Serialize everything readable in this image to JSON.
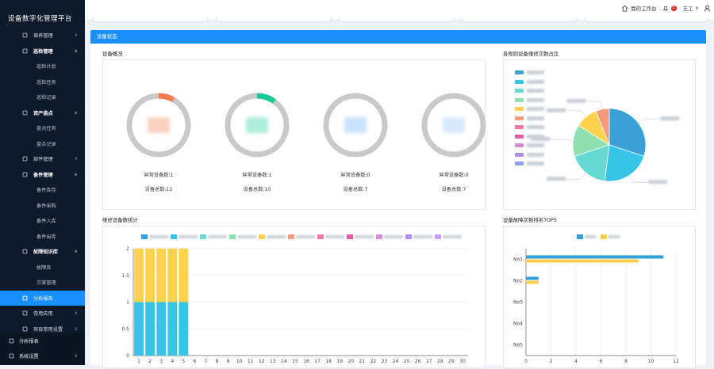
{
  "app": {
    "title": "设备数字化管理平台"
  },
  "sidebar": {
    "items": [
      {
        "label": "保养管理",
        "level": 1,
        "open": false,
        "icon": "doc-icon"
      },
      {
        "label": "巡检管理",
        "level": 1,
        "open": true,
        "icon": "gear-icon"
      },
      {
        "label": "巡检计划",
        "level": 2
      },
      {
        "label": "巡检任务",
        "level": 2
      },
      {
        "label": "巡检记录",
        "level": 2
      },
      {
        "label": "资产盘点",
        "level": 1,
        "open": true,
        "icon": "gear-icon"
      },
      {
        "label": "盘点任务",
        "level": 2
      },
      {
        "label": "盘点记录",
        "level": 2
      },
      {
        "label": "部件管理",
        "level": 1,
        "open": false,
        "icon": "wrench-icon"
      },
      {
        "label": "备件管理",
        "level": 1,
        "open": true,
        "icon": "parts-icon"
      },
      {
        "label": "备件库存",
        "level": 2
      },
      {
        "label": "备件采购",
        "level": 2
      },
      {
        "label": "备件入库",
        "level": 2
      },
      {
        "label": "备件出库",
        "level": 2
      },
      {
        "label": "故障知识库",
        "level": 1,
        "open": true,
        "icon": "book-icon"
      },
      {
        "label": "故障库",
        "level": 2
      },
      {
        "label": "方案管理",
        "level": 2
      },
      {
        "label": "分析报告",
        "level": 1,
        "active": true,
        "icon": "user-icon"
      },
      {
        "label": "常用应用",
        "level": 1,
        "open": false,
        "icon": "apps-icon"
      },
      {
        "label": "项目常用设置",
        "level": 1,
        "open": false,
        "icon": "apps-icon"
      },
      {
        "label": "分析报表",
        "level": 0,
        "icon": "report-icon"
      },
      {
        "label": "系统设置",
        "level": 0,
        "open": false,
        "icon": "settings-icon"
      }
    ]
  },
  "topbar": {
    "workbench": "我的工作台",
    "notifications": "0",
    "user": "王工"
  },
  "banner": {
    "title": "设备状态"
  },
  "sections": {
    "overview": "设备概况",
    "ratio": "各规则设备维修次数占比",
    "repair_stats": "维修设备数统计",
    "fault_rank": "设备故障次数排名TOP5"
  },
  "gauges": [
    {
      "abnormal": "异常设备数:1",
      "total": "设备总数:12",
      "ratio": 0.0833,
      "color": "#f47c4e"
    },
    {
      "abnormal": "异常设备数:1",
      "total": "设备总数:10",
      "ratio": 0.1,
      "color": "#19c999"
    },
    {
      "abnormal": "异常设备数:0",
      "total": "设备总数:7",
      "ratio": 0,
      "color": "#6aaef2"
    },
    {
      "abnormal": "异常设备数:0",
      "total": "设备总数:7",
      "ratio": 0,
      "color": "#8fc1f0"
    }
  ],
  "pie": {
    "legend_colors": [
      "#3aa0d8",
      "#36c5e6",
      "#66d9d3",
      "#8fe0b0",
      "#ffd24d",
      "#f59a7c",
      "#f07ba0",
      "#e35fa5",
      "#d38bd8",
      "#b08fe6",
      "#8f9ff0"
    ],
    "slices": [
      {
        "value": 30,
        "color": "#3aa0d8"
      },
      {
        "value": 22,
        "color": "#36c5e6"
      },
      {
        "value": 18,
        "color": "#66d9d3"
      },
      {
        "value": 14,
        "color": "#8fe0b0"
      },
      {
        "value": 10,
        "color": "#ffd24d"
      },
      {
        "value": 6,
        "color": "#f59a7c"
      }
    ]
  },
  "chart_data": [
    {
      "type": "bar",
      "stacked": true,
      "categories": [
        "1",
        "2",
        "3",
        "4",
        "5",
        "6",
        "7",
        "8",
        "9",
        "10",
        "11",
        "12",
        "13",
        "14",
        "15",
        "16",
        "17",
        "18",
        "19",
        "20",
        "21",
        "22",
        "23",
        "24",
        "25",
        "26",
        "27",
        "28",
        "29",
        "30"
      ],
      "series": [
        {
          "color": "#36c5e6",
          "values": [
            1,
            1,
            1,
            1,
            1,
            0,
            0,
            0,
            0,
            0,
            0,
            0,
            0,
            0,
            0,
            0,
            0,
            0,
            0,
            0,
            0,
            0,
            0,
            0,
            0,
            0,
            0,
            0,
            0,
            0
          ]
        },
        {
          "color": "#ffd24d",
          "values": [
            1,
            1,
            1,
            1,
            1,
            0,
            0,
            0,
            0,
            0,
            0,
            0,
            0,
            0,
            0,
            0,
            0,
            0,
            0,
            0,
            0,
            0,
            0,
            0,
            0,
            0,
            0,
            0,
            0,
            0
          ]
        }
      ],
      "ylim": [
        0,
        2
      ],
      "yticks": [
        "0",
        "0.5",
        "1",
        "1.5",
        "2"
      ],
      "legend_colors": [
        "#3aa0d8",
        "#36c5e6",
        "#66d9d3",
        "#8fe0b0",
        "#ffd24d",
        "#f59a7c",
        "#f07ba0",
        "#e35fa5",
        "#d38bd8",
        "#b08fe6",
        "#c9a0f0"
      ]
    },
    {
      "type": "bar",
      "orientation": "horizontal",
      "categories": [
        "No1",
        "No2",
        "No3",
        "No4",
        "No5"
      ],
      "series": [
        {
          "color": "#2f9fd8",
          "values": [
            11,
            1,
            0,
            0,
            0
          ]
        },
        {
          "color": "#ffcf4a",
          "values": [
            9,
            1,
            0,
            0,
            0
          ]
        }
      ],
      "xlim": [
        0,
        12
      ],
      "xticks": [
        "0",
        "2",
        "4",
        "6",
        "8",
        "10",
        "12"
      ]
    }
  ]
}
